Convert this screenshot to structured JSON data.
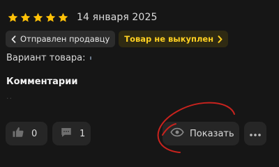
{
  "review": {
    "rating": 5,
    "rating_max": 5,
    "date": "14 января 2025",
    "star_color": "#FFC107"
  },
  "badges": {
    "sent_to_seller": "Отправлен продавцу",
    "not_bought": "Товар не выкуплен",
    "not_bought_color": "#FFD021"
  },
  "variant": {
    "label": "Вариант товара:"
  },
  "comments": {
    "heading": "Комментарии"
  },
  "actions": {
    "likes_count": "0",
    "comments_count": "1",
    "show_label": "Показать",
    "icons": [
      "thumbs-up-icon",
      "comment-icon",
      "eye-icon",
      "more-dots-icon"
    ]
  },
  "annotation": {
    "color": "#C8231E"
  }
}
